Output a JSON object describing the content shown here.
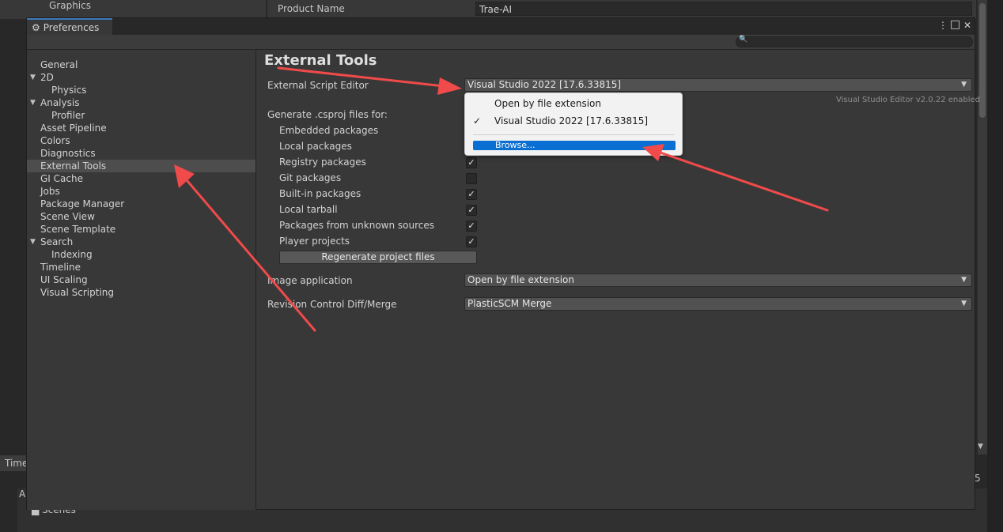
{
  "background": {
    "project_settings_item": "Graphics",
    "product_name_label": "Product Name",
    "product_name_value": "Trae-AI",
    "bottom_tab": "Time",
    "bottom_a": "A",
    "bottom_scenes": "Scenes",
    "bottom_number": "5"
  },
  "window": {
    "title": "Preferences",
    "menu_icon": "⋮",
    "maximize_icon": "□",
    "close_icon": "✕"
  },
  "sidebar": {
    "items": [
      {
        "label": "General",
        "level": 0,
        "expandable": false
      },
      {
        "label": "2D",
        "level": 0,
        "expandable": true
      },
      {
        "label": "Physics",
        "level": 1,
        "expandable": false
      },
      {
        "label": "Analysis",
        "level": 0,
        "expandable": true
      },
      {
        "label": "Profiler",
        "level": 1,
        "expandable": false
      },
      {
        "label": "Asset Pipeline",
        "level": 0,
        "expandable": false
      },
      {
        "label": "Colors",
        "level": 0,
        "expandable": false
      },
      {
        "label": "Diagnostics",
        "level": 0,
        "expandable": false
      },
      {
        "label": "External Tools",
        "level": 0,
        "expandable": false,
        "selected": true
      },
      {
        "label": "GI Cache",
        "level": 0,
        "expandable": false
      },
      {
        "label": "Jobs",
        "level": 0,
        "expandable": false
      },
      {
        "label": "Package Manager",
        "level": 0,
        "expandable": false
      },
      {
        "label": "Scene View",
        "level": 0,
        "expandable": false
      },
      {
        "label": "Scene Template",
        "level": 0,
        "expandable": false
      },
      {
        "label": "Search",
        "level": 0,
        "expandable": true
      },
      {
        "label": "Indexing",
        "level": 1,
        "expandable": false
      },
      {
        "label": "Timeline",
        "level": 0,
        "expandable": false
      },
      {
        "label": "UI Scaling",
        "level": 0,
        "expandable": false
      },
      {
        "label": "Visual Scripting",
        "level": 0,
        "expandable": false
      }
    ]
  },
  "content": {
    "title": "External Tools",
    "script_editor_label": "External Script Editor",
    "script_editor_value": "Visual Studio 2022 [17.6.33815]",
    "editor_version_note": "Visual Studio Editor v2.0.22 enabled",
    "csproj_header": "Generate .csproj files for:",
    "csproj_options": [
      {
        "label": "Embedded packages",
        "checked": true
      },
      {
        "label": "Local packages",
        "checked": true
      },
      {
        "label": "Registry packages",
        "checked": true
      },
      {
        "label": "Git packages",
        "checked": false
      },
      {
        "label": "Built-in packages",
        "checked": true
      },
      {
        "label": "Local tarball",
        "checked": true
      },
      {
        "label": "Packages from unknown sources",
        "checked": true
      },
      {
        "label": "Player projects",
        "checked": true
      }
    ],
    "regenerate_button": "Regenerate project files",
    "image_app_label": "Image application",
    "image_app_value": "Open by file extension",
    "revision_label": "Revision Control Diff/Merge",
    "revision_value": "PlasticSCM Merge"
  },
  "popup": {
    "items": [
      {
        "label": "Open by file extension",
        "checked": false
      },
      {
        "label": "Visual Studio 2022 [17.6.33815]",
        "checked": true
      }
    ],
    "browse_label": "Browse..."
  },
  "colors": {
    "accent": "#0a6fd2",
    "annotation_arrow": "#f04a4a",
    "window_bg": "#383838",
    "selected_row": "#4d4d4d"
  }
}
